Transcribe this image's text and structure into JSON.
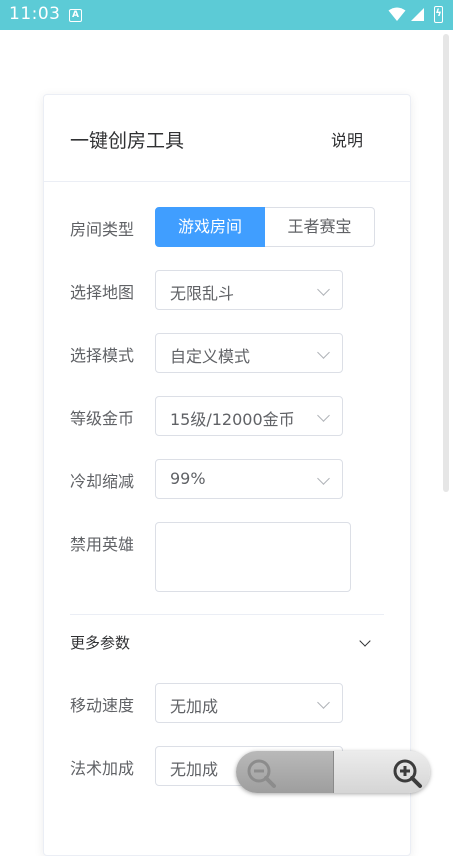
{
  "status_bar": {
    "time": "11:03",
    "notification_icon": "A"
  },
  "card": {
    "title": "一键创房工具",
    "help_link": "说明"
  },
  "room_type": {
    "label": "房间类型",
    "options": [
      "游戏房间",
      "王者赛宝"
    ],
    "selected": "游戏房间"
  },
  "map": {
    "label": "选择地图",
    "value": "无限乱斗"
  },
  "mode": {
    "label": "选择模式",
    "value": "自定义模式"
  },
  "level_gold": {
    "label": "等级金币",
    "value": "15级/12000金币"
  },
  "cooldown": {
    "label": "冷却缩减",
    "value": "99%"
  },
  "banned_heroes": {
    "label": "禁用英雄",
    "value": ""
  },
  "more_params": {
    "label": "更多参数"
  },
  "move_speed": {
    "label": "移动速度",
    "value": "无加成"
  },
  "magic_bonus": {
    "label": "法术加成",
    "value": "无加成"
  },
  "zoom_controls": {
    "zoom_out_icon": "zoom-out-icon",
    "zoom_in_icon": "zoom-in-icon"
  },
  "colors": {
    "accent": "#409eff",
    "status_bar": "#5ccbd6"
  }
}
